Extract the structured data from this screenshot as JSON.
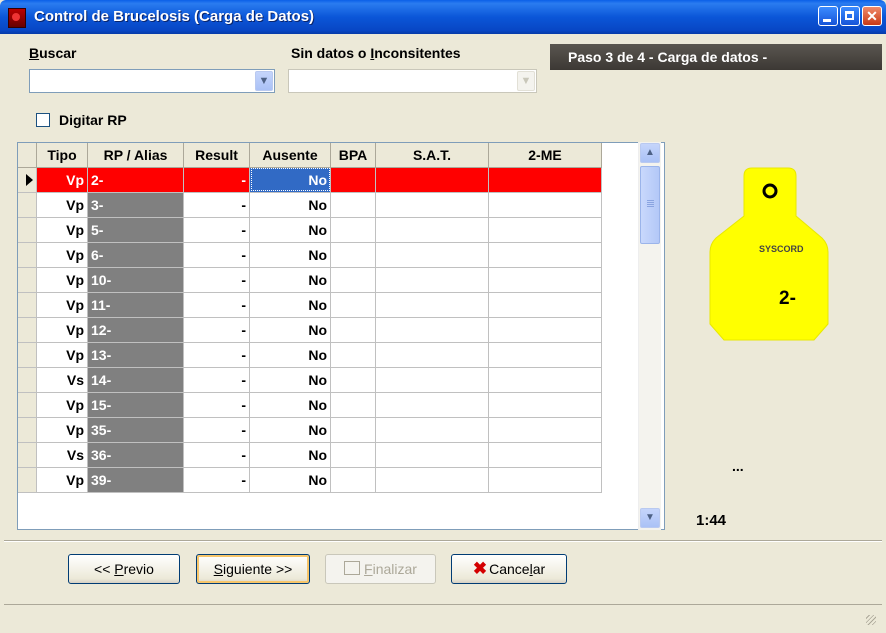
{
  "window": {
    "title": "Control de Brucelosis (Carga de Datos)"
  },
  "search": {
    "buscar_label_u": "B",
    "buscar_label_rest": "uscar",
    "sin_label_pre": "Sin datos o ",
    "sin_label_u": "I",
    "sin_label_rest": "nconsitentes",
    "buscar_value": "",
    "sin_value": ""
  },
  "step_banner": "Paso 3 de 4  - Carga de datos -",
  "digitar": {
    "label": "Digitar RP",
    "checked": false
  },
  "grid": {
    "columns": [
      "Tipo",
      "RP / Alias",
      "Result",
      "Ausente",
      "BPA",
      "S.A.T.",
      "2-ME"
    ],
    "rows": [
      {
        "tipo": "Vp",
        "rp": "2-",
        "result": "-",
        "ausente": "No",
        "bpa": "",
        "sat": "",
        "me": ""
      },
      {
        "tipo": "Vp",
        "rp": "3-",
        "result": "-",
        "ausente": "No",
        "bpa": "",
        "sat": "",
        "me": ""
      },
      {
        "tipo": "Vp",
        "rp": "5-",
        "result": "-",
        "ausente": "No",
        "bpa": "",
        "sat": "",
        "me": ""
      },
      {
        "tipo": "Vp",
        "rp": "6-",
        "result": "-",
        "ausente": "No",
        "bpa": "",
        "sat": "",
        "me": ""
      },
      {
        "tipo": "Vp",
        "rp": "10-",
        "result": "-",
        "ausente": "No",
        "bpa": "",
        "sat": "",
        "me": ""
      },
      {
        "tipo": "Vp",
        "rp": "11-",
        "result": "-",
        "ausente": "No",
        "bpa": "",
        "sat": "",
        "me": ""
      },
      {
        "tipo": "Vp",
        "rp": "12-",
        "result": "-",
        "ausente": "No",
        "bpa": "",
        "sat": "",
        "me": ""
      },
      {
        "tipo": "Vp",
        "rp": "13-",
        "result": "-",
        "ausente": "No",
        "bpa": "",
        "sat": "",
        "me": ""
      },
      {
        "tipo": "Vs",
        "rp": "14-",
        "result": "-",
        "ausente": "No",
        "bpa": "",
        "sat": "",
        "me": ""
      },
      {
        "tipo": "Vp",
        "rp": "15-",
        "result": "-",
        "ausente": "No",
        "bpa": "",
        "sat": "",
        "me": ""
      },
      {
        "tipo": "Vp",
        "rp": "35-",
        "result": "-",
        "ausente": "No",
        "bpa": "",
        "sat": "",
        "me": ""
      },
      {
        "tipo": "Vs",
        "rp": "36-",
        "result": "-",
        "ausente": "No",
        "bpa": "",
        "sat": "",
        "me": ""
      },
      {
        "tipo": "Vp",
        "rp": "39-",
        "result": "-",
        "ausente": "No",
        "bpa": "",
        "sat": "",
        "me": ""
      }
    ],
    "selected_row": 0
  },
  "tag": {
    "brand": "SYSCORD",
    "number": "2-",
    "color": "#ffff00"
  },
  "side": {
    "dots": "...",
    "timer": "1:44"
  },
  "buttons": {
    "previo_pre": "<< ",
    "previo_u": "P",
    "previo_rest": "revio",
    "siguiente_u": "S",
    "siguiente_rest": "iguiente >>",
    "finalizar_u": "F",
    "finalizar_rest": "inalizar",
    "cancelar_pre": "Cance",
    "cancelar_u": "l",
    "cancelar_rest": "ar"
  },
  "icons": {
    "app": "app-icon",
    "minimize": "minimize-icon",
    "maximize": "maximize-icon",
    "close": "close-icon",
    "dropdown": "chevron-down-icon",
    "finalizar": "print-icon",
    "cancelar": "red-x-icon",
    "row_pointer": "row-pointer-icon"
  },
  "colors": {
    "selected_row": "#ff0000",
    "selected_cell": "#316ac5",
    "rp_column": "#808080",
    "titlebar": "#0846c4"
  }
}
